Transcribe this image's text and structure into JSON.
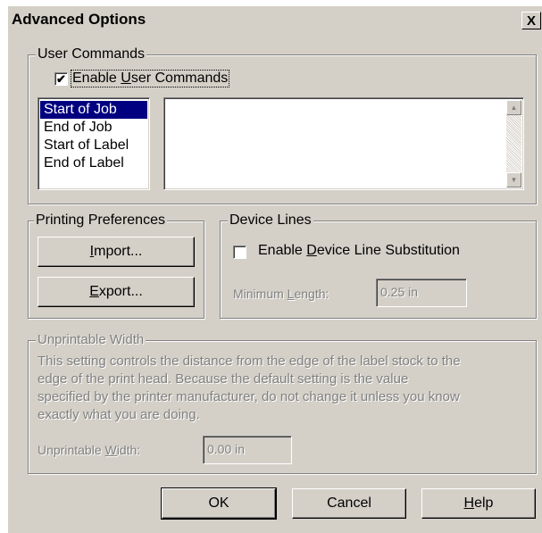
{
  "window": {
    "title": "Advanced Options",
    "close_symbol": "X"
  },
  "user_commands": {
    "legend": "User Commands",
    "enable_pre": "Enable ",
    "enable_u": "U",
    "enable_post": "ser Commands",
    "enable_checked": true,
    "checkmark": "✔",
    "list_items": [
      "Start of Job",
      "End of Job",
      "Start of Label",
      "End of Label"
    ],
    "selected_index": 0,
    "command_text": "",
    "scroll_up": "▲",
    "scroll_down": "▼"
  },
  "printing_preferences": {
    "legend": "Printing Preferences",
    "import_u": "I",
    "import_rest": "mport...",
    "export_u": "E",
    "export_rest": "xport..."
  },
  "device_lines": {
    "legend": "Device Lines",
    "enable_pre": "Enable ",
    "enable_u": "D",
    "enable_post": "evice Line Substitution",
    "enable_checked": false,
    "min_length_pre": "Minimum ",
    "min_length_u": "L",
    "min_length_post": "ength:",
    "min_length_value": "0.25 in"
  },
  "unprintable": {
    "legend": "Unprintable Width",
    "description_lines": [
      "This setting controls the distance from the edge of the label stock to the",
      "edge of the print head.  Because the default setting is the value",
      "specified by the printer manufacturer, do not change it unless you know",
      "exactly what you are doing."
    ],
    "field_pre": "Unprintable ",
    "field_u": "W",
    "field_post": "idth:",
    "field_value": "0.00 in"
  },
  "buttons": {
    "ok": "OK",
    "cancel": "Cancel",
    "help_u": "H",
    "help_rest": "elp"
  }
}
